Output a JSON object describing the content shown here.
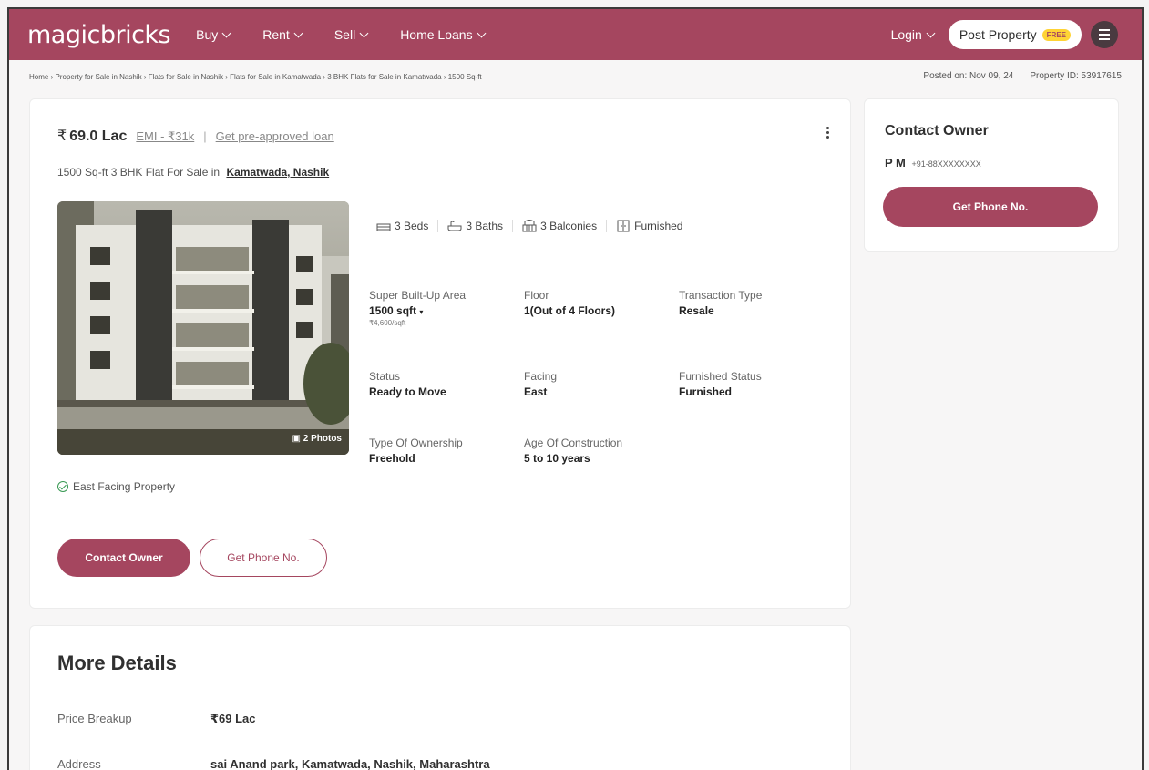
{
  "header": {
    "logo": "magicbricks",
    "nav": [
      "Buy",
      "Rent",
      "Sell",
      "Home Loans"
    ],
    "login": "Login",
    "post_property": "Post Property",
    "free_badge": "FREE"
  },
  "breadcrumb": {
    "path": "Home › Property for Sale in Nashik › Flats for Sale in Nashik › Flats for Sale in Kamatwada › 3 BHK Flats for Sale in Kamatwada › 1500 Sq-ft",
    "posted_on": "Posted on: Nov 09, 24",
    "property_id": "Property ID: 53917615"
  },
  "listing": {
    "price": "69.0 Lac",
    "currency_symbol": "₹",
    "emi": "EMI - ₹31k",
    "loan_link": "Get pre-approved loan",
    "subtitle_prefix": "1500 Sq-ft 3 BHK Flat For Sale in",
    "location": "Kamatwada, Nashik",
    "photo_count": "2 Photos",
    "amenities": [
      "3 Beds",
      "3 Baths",
      "3 Balconies",
      "Furnished"
    ],
    "specs": {
      "super_area_label": "Super Built-Up Area",
      "super_area_value": "1500 sqft",
      "price_per_sqft": "₹4,600/sqft",
      "floor_label": "Floor",
      "floor_value": "1(Out of 4 Floors)",
      "transaction_label": "Transaction Type",
      "transaction_value": "Resale",
      "status_label": "Status",
      "status_value": "Ready to Move",
      "facing_label": "Facing",
      "facing_value": "East",
      "furnished_label": "Furnished Status",
      "furnished_value": "Furnished",
      "ownership_label": "Type Of Ownership",
      "ownership_value": "Freehold",
      "age_label": "Age Of Construction",
      "age_value": "5 to 10 years"
    },
    "facing_note": "East Facing Property",
    "contact_button": "Contact Owner",
    "phone_button": "Get Phone No."
  },
  "side": {
    "title": "Contact Owner",
    "owner_name": "P M",
    "owner_phone": "+91-88XXXXXXXX",
    "phone_button": "Get Phone No."
  },
  "details": {
    "title": "More Details",
    "price_breakup_label": "Price Breakup",
    "price_breakup_value": "₹69 Lac",
    "address_label": "Address",
    "address_value": "sai Anand park, Kamatwada, Nashik, Maharashtra"
  },
  "colors": {
    "brand": "#a5465f",
    "badge": "#ffd335"
  }
}
